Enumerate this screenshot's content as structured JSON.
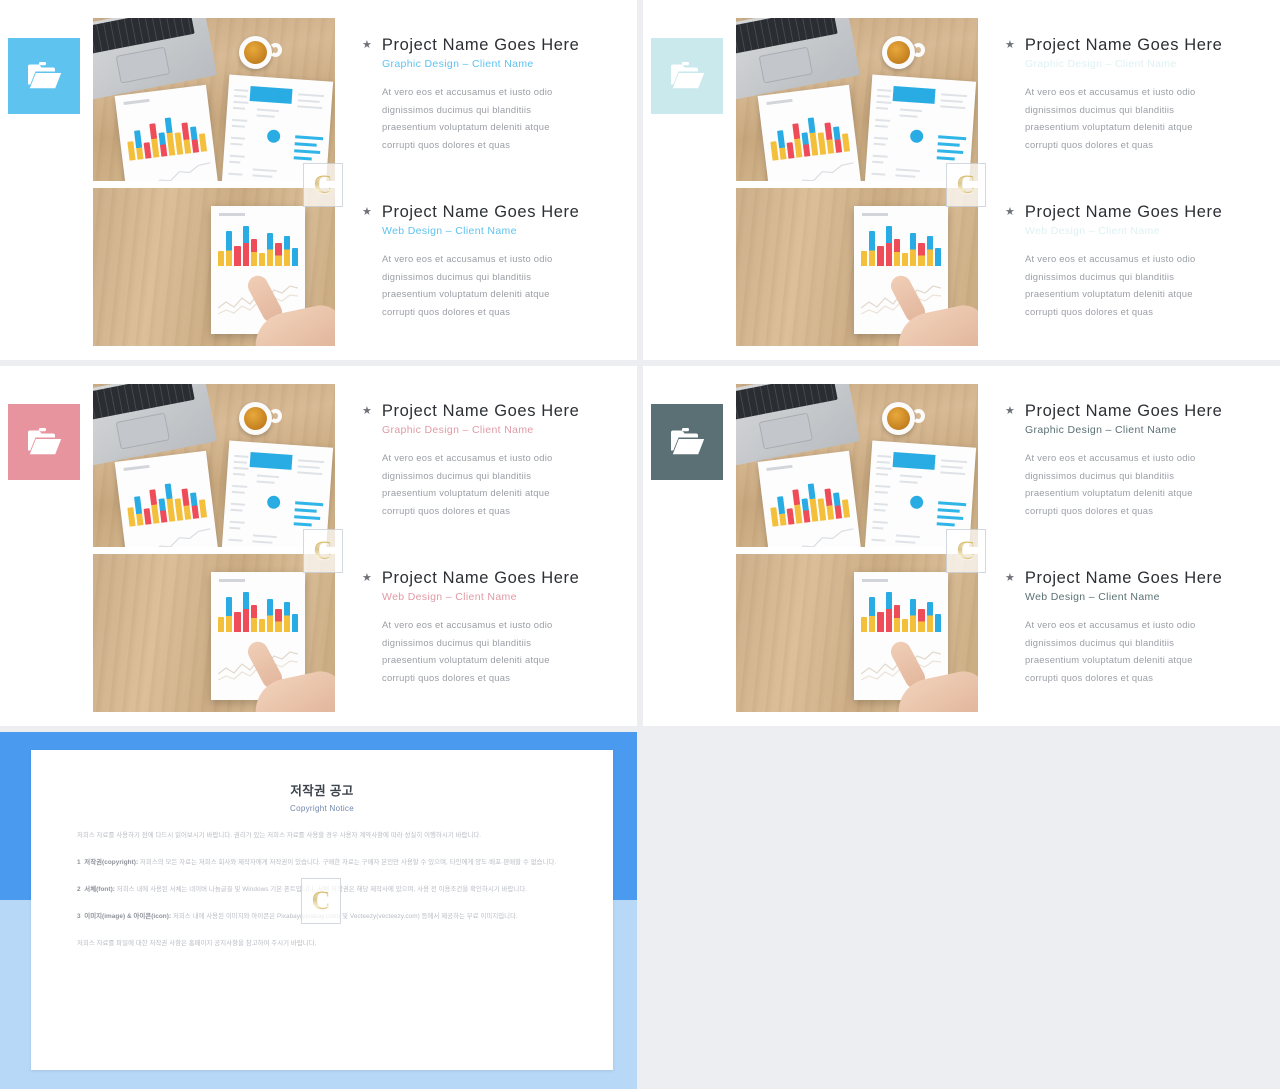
{
  "meta": {
    "layout": "four portfolio slide thumbnails in a 2x2 grid with a copyright-notice slide below",
    "canvas_background": "#eceef1",
    "watermark_letter": "C"
  },
  "panels": [
    {
      "id": "panel-top-left",
      "accent_color": "#5ec3ef",
      "tile_icon": "folder-icon",
      "subtitle_color": "#5ec3ef",
      "entries": [
        {
          "bullet": "★",
          "title": "Project Name Goes Here",
          "subtitle": "Graphic Design – Client Name",
          "body": [
            "At vero eos et accusamus et iusto odio",
            "dignissimos  ducimus  qui  blanditiis",
            "praesentium  voluptatum  deleniti  atque",
            "corrupti  quos dolores  et quas"
          ]
        },
        {
          "bullet": "★",
          "title": "Project Name Goes Here",
          "subtitle": "Web Design – Client Name",
          "body": [
            "At vero eos et accusamus et iusto odio",
            "dignissimos  ducimus  qui  blanditiis",
            "praesentium  voluptatum  deleniti  atque",
            "corrupti  quos dolores  et quas"
          ]
        }
      ]
    },
    {
      "id": "panel-top-right",
      "accent_color": "#c9e9ec",
      "tile_icon": "folder-icon",
      "subtitle_color": "#dff1f1",
      "entries": [
        {
          "bullet": "★",
          "title": "Project Name Goes Here",
          "subtitle": "Graphic Design – Client Name",
          "body": [
            "At vero eos et accusamus et iusto odio",
            "dignissimos  ducimus  qui  blanditiis",
            "praesentium  voluptatum  deleniti  atque",
            "corrupti  quos dolores  et quas"
          ]
        },
        {
          "bullet": "★",
          "title": "Project Name Goes Here",
          "subtitle": "Web Design – Client Name",
          "body": [
            "At vero eos et accusamus et iusto odio",
            "dignissimos  ducimus  qui  blanditiis",
            "praesentium  voluptatum  deleniti  atque",
            "corrupti  quos dolores  et quas"
          ]
        }
      ]
    },
    {
      "id": "panel-bottom-left",
      "accent_color": "#e8949f",
      "tile_icon": "folder-icon",
      "subtitle_color": "#e09aa4",
      "entries": [
        {
          "bullet": "★",
          "title": "Project Name Goes Here",
          "subtitle": "Graphic Design – Client Name",
          "body": [
            "At vero eos et accusamus et iusto odio",
            "dignissimos  ducimus  qui  blanditiis",
            "praesentium  voluptatum  deleniti  atque",
            "corrupti  quos dolores  et quas"
          ]
        },
        {
          "bullet": "★",
          "title": "Project Name Goes Here",
          "subtitle": "Web Design – Client Name",
          "body": [
            "At vero eos et accusamus et iusto odio",
            "dignissimos  ducimus  qui  blanditiis",
            "praesentium  voluptatum  deleniti  atque",
            "corrupti  quos dolores  et quas"
          ]
        }
      ]
    },
    {
      "id": "panel-bottom-right",
      "accent_color": "#5b7074",
      "tile_icon": "folder-icon",
      "subtitle_color": "#5b7074",
      "entries": [
        {
          "bullet": "★",
          "title": "Project Name Goes Here",
          "subtitle": "Graphic Design – Client Name",
          "body": [
            "At vero eos et accusamus et iusto odio",
            "dignissimos  ducimus  qui  blanditiis",
            "praesentium  voluptatum  deleniti  atque",
            "corrupti  quos dolores  et quas"
          ]
        },
        {
          "bullet": "★",
          "title": "Project Name Goes Here",
          "subtitle": "Web Design – Client Name",
          "body": [
            "At vero eos et accusamus et iusto odio",
            "dignissimos  ducimus  qui  blanditiis",
            "praesentium  voluptatum  deleniti  atque",
            "corrupti  quos dolores  et quas"
          ]
        }
      ]
    }
  ],
  "notice": {
    "frame_color": "#4a9bf0",
    "frame_color_light": "#b7d9f7",
    "title": "저작권 공고",
    "subtitle": "Copyright Notice",
    "intro": "저희스 자료를 사용하기 전에 다드시 읽어보시기 바랍니다. 권리가 있는 저희스 자료를 사용할 경우 사용자 계약사항에 따라 성실히 이행하시기 바랍니다.",
    "sections": [
      {
        "number": "1",
        "heading": "저작권(copyright)",
        "text": "저희스의 모든 자료는 저희스 회사와 제작자에게 저작권이 있습니다. 구매한 자료는 구매자 본인만 사용할 수 있으며, 타인에게 양도·배포·판매할 수 없습니다."
      },
      {
        "number": "2",
        "heading": "서체(font)",
        "text": "저희스 내에 사용된 서체는 네이버 나눔글꼴 및 Windows 기본 폰트입니다. 서체 저작권은 해당 제작사에 있으며, 사용 전 이용조건을 확인하시기 바랍니다."
      },
      {
        "number": "3",
        "heading": "이미지(image) & 아이콘(icon)",
        "text": "저희스 내에 사용된 이미지와 아이콘은 Pixabay(pixabay.com) 및 Vecteezy(vecteezy.com) 등에서 제공하는 무료 이미지입니다."
      }
    ],
    "closing": "저희스 자료를 파일에 대한 저작권 사항은 홈페이지 공지사항을 참고하여 주시기 바랍니다."
  }
}
